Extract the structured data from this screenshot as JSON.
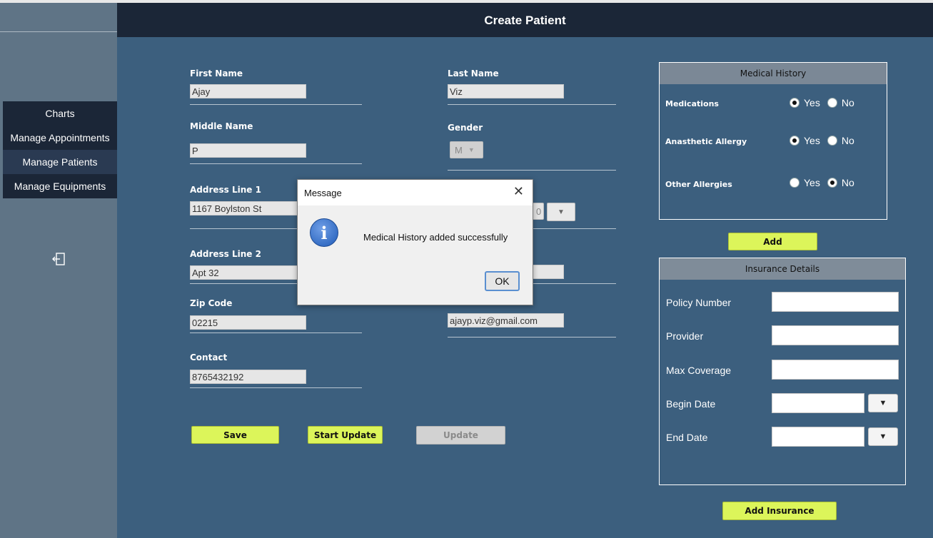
{
  "window": {
    "title": "Create Patient"
  },
  "sidebar": {
    "items": [
      {
        "label": "Charts"
      },
      {
        "label": "Manage Appointments"
      },
      {
        "label": "Manage Patients"
      },
      {
        "label": "Manage Equipments"
      }
    ],
    "logout_icon": "logout-icon"
  },
  "form": {
    "first_name": {
      "label": "First Name",
      "value": "Ajay"
    },
    "last_name": {
      "label": "Last Name",
      "value": "Viz"
    },
    "middle_name": {
      "label": "Middle Name",
      "value": "P"
    },
    "gender": {
      "label": "Gender",
      "value": "M"
    },
    "address1": {
      "label": "Address Line 1",
      "value": "1167 Boylston St"
    },
    "address2": {
      "label": "Address Line 2",
      "value": "Apt 32"
    },
    "zip": {
      "label": "Zip Code",
      "value": "02215"
    },
    "email": {
      "value": "ajayp.viz@gmail.com"
    },
    "contact": {
      "label": "Contact",
      "value": "8765432192"
    },
    "partial_combo_value": "0"
  },
  "buttons": {
    "save": "Save",
    "start_update": "Start Update",
    "update": "Update",
    "add": "Add",
    "add_insurance": "Add Insurance"
  },
  "medical_history": {
    "title": "Medical History",
    "rows": [
      {
        "label": "Medications",
        "yes": "Yes",
        "no": "No",
        "selected": "Yes"
      },
      {
        "label": "Anasthetic Allergy",
        "yes": "Yes",
        "no": "No",
        "selected": "Yes"
      },
      {
        "label": "Other Allergies",
        "yes": "Yes",
        "no": "No",
        "selected": "No"
      }
    ]
  },
  "insurance": {
    "title": "Insurance Details",
    "policy_number": "Policy Number",
    "provider": "Provider",
    "max_coverage": "Max Coverage",
    "begin_date": "Begin Date",
    "end_date": "End Date"
  },
  "dialog": {
    "title": "Message",
    "close_glyph": "✕",
    "icon_glyph": "i",
    "message": "Medical History added successfully",
    "ok": "OK"
  },
  "colors": {
    "background": "#3c5f7e",
    "header": "#1b2637",
    "accent_button": "#dcf55a"
  }
}
